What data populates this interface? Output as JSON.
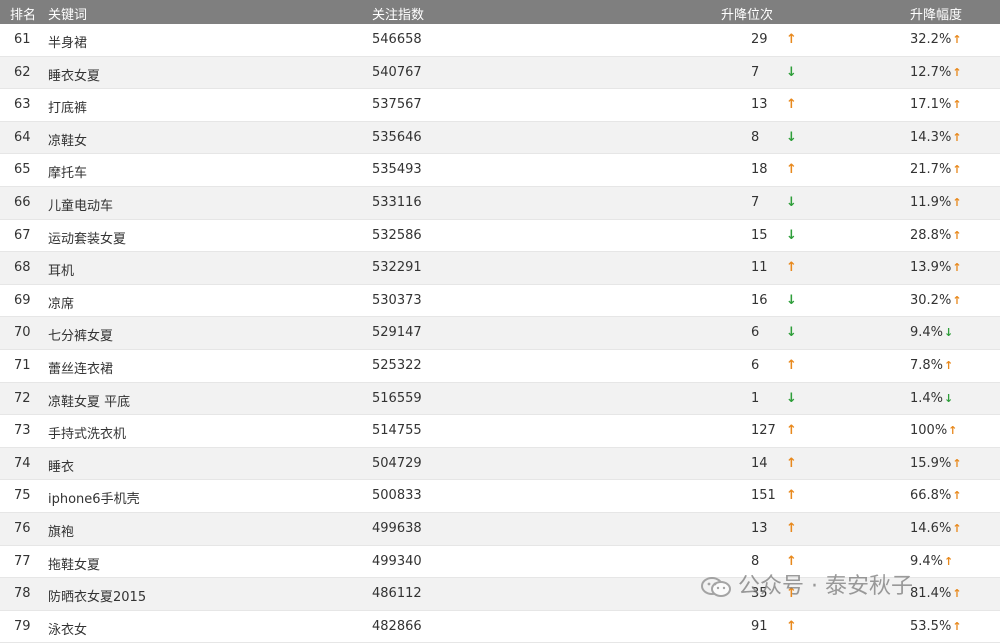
{
  "header": {
    "rank": "排名",
    "keyword": "关键词",
    "index": "关注指数",
    "change": "升降位次",
    "pct": "升降幅度"
  },
  "colors": {
    "up": "#e8891d",
    "down": "#2e9e3a",
    "header_bg": "#7f7f7f"
  },
  "rows": [
    {
      "rank": "61",
      "keyword": " 半身裙",
      "index": "546658",
      "change": "29",
      "dir": "up",
      "pct": "32.2%",
      "pct_dir": "up"
    },
    {
      "rank": "62",
      "keyword": "睡衣女夏",
      "index": "540767",
      "change": "7",
      "dir": "down",
      "pct": "12.7%",
      "pct_dir": "up"
    },
    {
      "rank": "63",
      "keyword": "打底裤",
      "index": "537567",
      "change": "13",
      "dir": "up",
      "pct": "17.1%",
      "pct_dir": "up"
    },
    {
      "rank": "64",
      "keyword": "凉鞋女",
      "index": "535646",
      "change": "8",
      "dir": "down",
      "pct": "14.3%",
      "pct_dir": "up"
    },
    {
      "rank": "65",
      "keyword": "摩托车",
      "index": "535493",
      "change": "18",
      "dir": "up",
      "pct": "21.7%",
      "pct_dir": "up"
    },
    {
      "rank": "66",
      "keyword": "儿童电动车",
      "index": "533116",
      "change": "7",
      "dir": "down",
      "pct": "11.9%",
      "pct_dir": "up"
    },
    {
      "rank": "67",
      "keyword": "运动套装女夏",
      "index": "532586",
      "change": "15",
      "dir": "down",
      "pct": "28.8%",
      "pct_dir": "up"
    },
    {
      "rank": "68",
      "keyword": "耳机",
      "index": "532291",
      "change": "11",
      "dir": "up",
      "pct": "13.9%",
      "pct_dir": "up"
    },
    {
      "rank": "69",
      "keyword": "凉席",
      "index": "530373",
      "change": "16",
      "dir": "down",
      "pct": "30.2%",
      "pct_dir": "up"
    },
    {
      "rank": "70",
      "keyword": "七分裤女夏",
      "index": "529147",
      "change": "6",
      "dir": "down",
      "pct": "9.4%",
      "pct_dir": "down"
    },
    {
      "rank": "71",
      "keyword": "蕾丝连衣裙",
      "index": "525322",
      "change": "6",
      "dir": "up",
      "pct": "7.8%",
      "pct_dir": "up"
    },
    {
      "rank": "72",
      "keyword": "凉鞋女夏 平底",
      "index": "516559",
      "change": "1",
      "dir": "down",
      "pct": "1.4%",
      "pct_dir": "down"
    },
    {
      "rank": "73",
      "keyword": "手持式洗衣机",
      "index": "514755",
      "change": "127",
      "dir": "up",
      "pct": "100%",
      "pct_dir": "up"
    },
    {
      "rank": "74",
      "keyword": "睡衣",
      "index": "504729",
      "change": "14",
      "dir": "up",
      "pct": "15.9%",
      "pct_dir": "up"
    },
    {
      "rank": "75",
      "keyword": "iphone6手机壳",
      "index": "500833",
      "change": "151",
      "dir": "up",
      "pct": "66.8%",
      "pct_dir": "up"
    },
    {
      "rank": "76",
      "keyword": "旗袍",
      "index": "499638",
      "change": "13",
      "dir": "up",
      "pct": "14.6%",
      "pct_dir": "up"
    },
    {
      "rank": "77",
      "keyword": "拖鞋女夏",
      "index": "499340",
      "change": "8",
      "dir": "up",
      "pct": "9.4%",
      "pct_dir": "up"
    },
    {
      "rank": "78",
      "keyword": "防晒衣女夏2015",
      "index": "486112",
      "change": "35",
      "dir": "up",
      "pct": "81.4%",
      "pct_dir": "up"
    },
    {
      "rank": "79",
      "keyword": "泳衣女",
      "index": "482866",
      "change": "91",
      "dir": "up",
      "pct": "53.5%",
      "pct_dir": "up"
    }
  ],
  "watermark": {
    "text": "公众号 · 泰安秋子",
    "icon": "wechat-icon"
  }
}
